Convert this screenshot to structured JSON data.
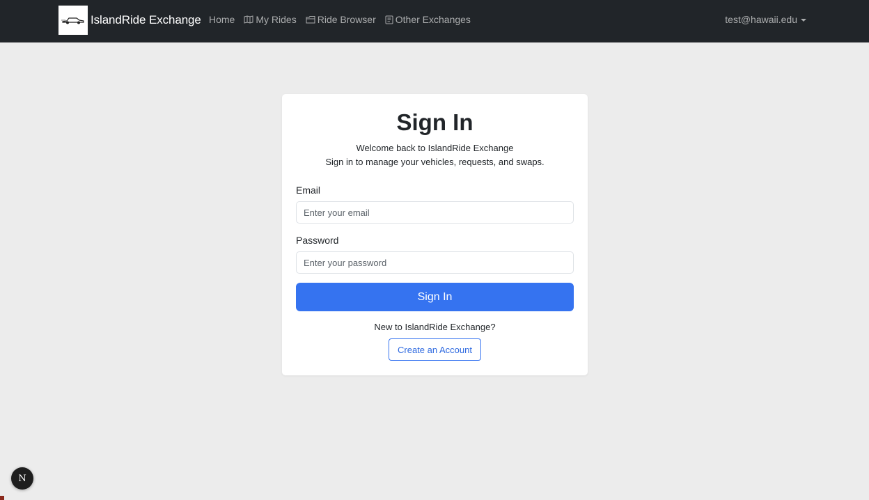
{
  "navbar": {
    "brand_text": "IslandRide Exchange",
    "links": [
      {
        "label": "Home",
        "icon": null
      },
      {
        "label": "My Rides",
        "icon": "map-icon"
      },
      {
        "label": "Ride Browser",
        "icon": "folder-icon"
      },
      {
        "label": "Other Exchanges",
        "icon": "document-icon"
      }
    ],
    "user_email": "test@hawaii.edu"
  },
  "signin": {
    "title": "Sign In",
    "subtitle_line1": "Welcome back to IslandRide Exchange",
    "subtitle_line2": "Sign in to manage your vehicles, requests, and swaps.",
    "email_label": "Email",
    "email_placeholder": "Enter your email",
    "email_value": "",
    "password_label": "Password",
    "password_placeholder": "Enter your password",
    "password_value": "",
    "submit_label": "Sign In",
    "signup_prompt": "New to IslandRide Exchange?",
    "create_account_label": "Create an Account"
  },
  "dev_badge": {
    "letter": "N"
  },
  "colors": {
    "navbar_bg": "#212529",
    "page_bg": "#ececec",
    "primary": "#3573f0"
  }
}
